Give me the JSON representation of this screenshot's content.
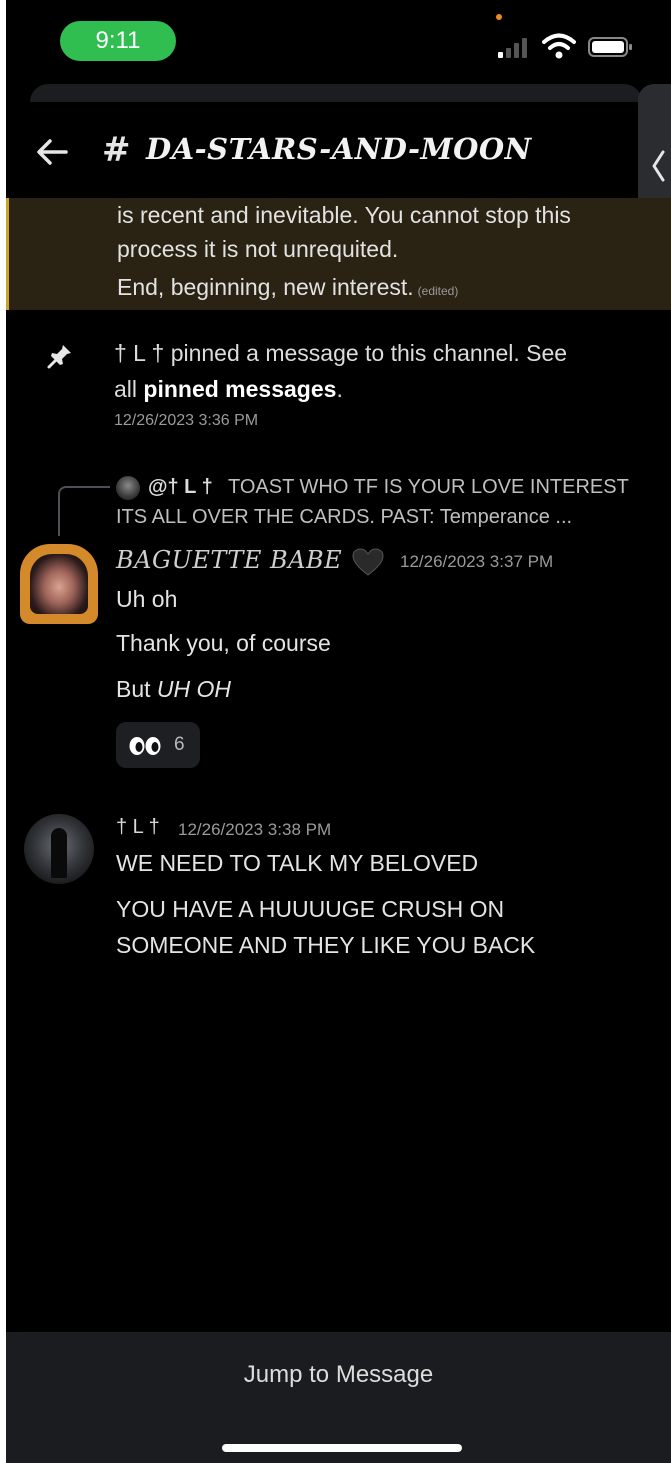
{
  "status_bar": {
    "time": "9:11"
  },
  "header": {
    "hash": "#",
    "channel_name": "DA-STARS-AND-MOON"
  },
  "highlighted_message": {
    "line1": "is recent and inevitable. You cannot stop this",
    "line2": "process it is not unrequited.",
    "line3": "End, beginning, new interest.",
    "edited": "(edited)"
  },
  "pin_notice": {
    "line1": "† L † pinned a message to this channel. See",
    "line2_prefix": "all ",
    "line2_link": "pinned messages",
    "line2_suffix": ".",
    "timestamp": "12/26/2023 3:36 PM"
  },
  "reply_preview": {
    "mention": "@† L †",
    "line1_rest": "TOAST WHO TF IS YOUR LOVE INTEREST",
    "line2": "ITS ALL OVER THE CARDS.   PAST: Temperance ..."
  },
  "message1": {
    "author": "BAGUETTE BABE",
    "timestamp": "12/26/2023 3:37 PM",
    "line1": "Uh oh",
    "line2": "Thank you, of course",
    "line3_prefix": "But ",
    "line3_italic": "UH OH",
    "reaction_count": "6"
  },
  "message2": {
    "author": "† L †",
    "timestamp": "12/26/2023 3:38 PM",
    "line1": "WE NEED TO TALK MY BELOVED",
    "line2": "YOU HAVE A HUUUUGE CRUSH ON",
    "line3": "SOMEONE AND THEY LIKE YOU BACK"
  },
  "bottom": {
    "jump_label": "Jump to Message"
  },
  "icons": {
    "back": "back-arrow-icon",
    "pin": "pin-icon",
    "heart": "black-heart-icon",
    "reaction": "eyes-emoji-icon",
    "side_tab": "chevron-left-icon"
  },
  "colors": {
    "status_pill": "#2fbe4f",
    "highlight_bg": "#2a2213",
    "highlight_border": "#c9a227",
    "bottom_bar": "#1b1c1f"
  }
}
